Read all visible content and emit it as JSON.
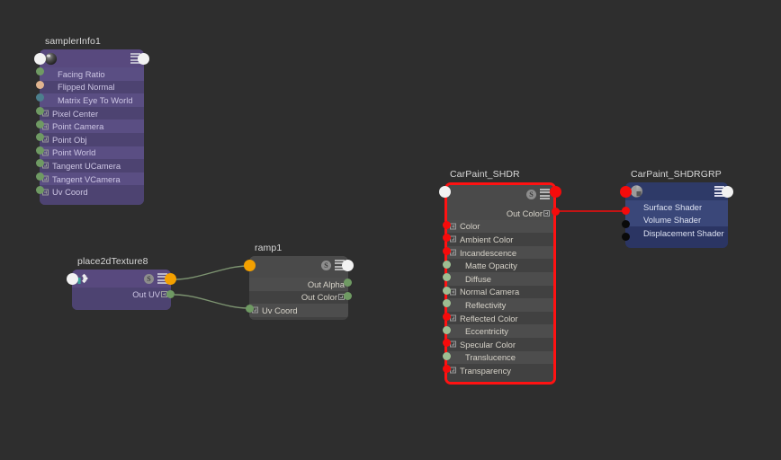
{
  "app": {
    "background_color": "#2e2e2e",
    "selection_color": "#ff1212"
  },
  "nodes": [
    {
      "id": "samplerInfo1",
      "title": "samplerInfo1",
      "icon": "sphere-shading-icon",
      "header_icons": [
        "stack-icon"
      ],
      "selected": false,
      "theme": "purple",
      "input_port": {
        "color": "#f2f2f2",
        "name": "node-input-port"
      },
      "output_port": {
        "color": "#f2f2f2",
        "name": "node-output-port"
      },
      "attributes": [
        {
          "label": "Facing Ratio",
          "port": "green",
          "expandable": false
        },
        {
          "label": "Flipped Normal",
          "port": "peach",
          "expandable": false
        },
        {
          "label": "Matrix Eye To World",
          "port": "teal",
          "expandable": false
        },
        {
          "label": "Pixel Center",
          "port": "green",
          "expandable": true
        },
        {
          "label": "Point Camera",
          "port": "green",
          "expandable": true
        },
        {
          "label": "Point Obj",
          "port": "green",
          "expandable": true
        },
        {
          "label": "Point World",
          "port": "green",
          "expandable": true
        },
        {
          "label": "Tangent UCamera",
          "port": "green",
          "expandable": true
        },
        {
          "label": "Tangent VCamera",
          "port": "green",
          "expandable": true
        },
        {
          "label": "Uv Coord",
          "port": "green",
          "expandable": true
        }
      ]
    },
    {
      "id": "place2dTexture8",
      "title": "place2dTexture8",
      "icon": "move-place2d-icon",
      "header_icons": [
        "badge-s",
        "stack-icon"
      ],
      "selected": false,
      "theme": "purple",
      "input_port": {
        "color": "#f2f2f2",
        "name": "node-input-port"
      },
      "output_port": {
        "color": "#f3a000",
        "name": "node-output-port"
      },
      "outputs": [
        {
          "label": "Out UV",
          "port": "green",
          "expandable": true
        }
      ]
    },
    {
      "id": "ramp1",
      "title": "ramp1",
      "icon": "",
      "header_icons": [
        "badge-s",
        "stack-icon"
      ],
      "selected": false,
      "theme": "dark",
      "input_port": {
        "color": "#f3a000",
        "name": "node-input-port"
      },
      "output_port": {
        "color": "#f2f2f2",
        "name": "node-output-port"
      },
      "outputs": [
        {
          "label": "Out Alpha",
          "port": "green",
          "expandable": false
        },
        {
          "label": "Out Color",
          "port": "green",
          "expandable": true
        }
      ],
      "attributes": [
        {
          "label": "Uv Coord",
          "port": "green",
          "expandable": true
        }
      ]
    },
    {
      "id": "CarPaint_SHDR",
      "title": "CarPaint_SHDR",
      "icon": "",
      "header_icons": [
        "badge-s",
        "stack-icon"
      ],
      "selected": true,
      "theme": "dark",
      "input_port": {
        "color": "#f2f2f2",
        "name": "node-input-port"
      },
      "output_port": {
        "color": "#f50b0b",
        "name": "node-output-port"
      },
      "outputs": [
        {
          "label": "Out Color",
          "port": "red",
          "expandable": true
        }
      ],
      "attributes": [
        {
          "label": "Color",
          "port": "red",
          "expandable": true
        },
        {
          "label": "Ambient Color",
          "port": "red",
          "expandable": true
        },
        {
          "label": "Incandescence",
          "port": "red",
          "expandable": true
        },
        {
          "label": "Matte Opacity",
          "port": "greenl",
          "expandable": false
        },
        {
          "label": "Diffuse",
          "port": "greenl",
          "expandable": false
        },
        {
          "label": "Normal Camera",
          "port": "greenl",
          "expandable": true
        },
        {
          "label": "Reflectivity",
          "port": "greenl",
          "expandable": false
        },
        {
          "label": "Reflected Color",
          "port": "red",
          "expandable": true
        },
        {
          "label": "Eccentricity",
          "port": "greenl",
          "expandable": false
        },
        {
          "label": "Specular Color",
          "port": "red",
          "expandable": true
        },
        {
          "label": "Translucence",
          "port": "greenl",
          "expandable": false
        },
        {
          "label": "Transparency",
          "port": "red",
          "expandable": true
        }
      ]
    },
    {
      "id": "CarPaint_SHDRGRP",
      "title": "CarPaint_SHDRGRP",
      "icon": "shading-group-icon",
      "header_icons": [
        "stack-icon"
      ],
      "selected": false,
      "theme": "blue",
      "input_port": {
        "color": "#f50b0b",
        "name": "node-input-port"
      },
      "output_port": {
        "color": "#f2f2f2",
        "name": "node-output-port"
      },
      "attributes": [
        {
          "label": "Surface Shader",
          "port": "red",
          "expandable": false
        },
        {
          "label": "Volume Shader",
          "port": "black",
          "expandable": false
        },
        {
          "label": "Displacement Shader",
          "port": "black",
          "expandable": false
        }
      ]
    }
  ],
  "connections": [
    {
      "from": "place2dTexture8.output",
      "to": "ramp1.input",
      "color": "#7d9471"
    },
    {
      "from": "place2dTexture8.OutUV",
      "to": "ramp1.UvCoord",
      "color": "#7d9471"
    },
    {
      "from": "CarPaint_SHDR.OutColor",
      "to": "CarPaint_SHDRGRP.SurfaceShader",
      "color": "#f50b0b"
    }
  ]
}
